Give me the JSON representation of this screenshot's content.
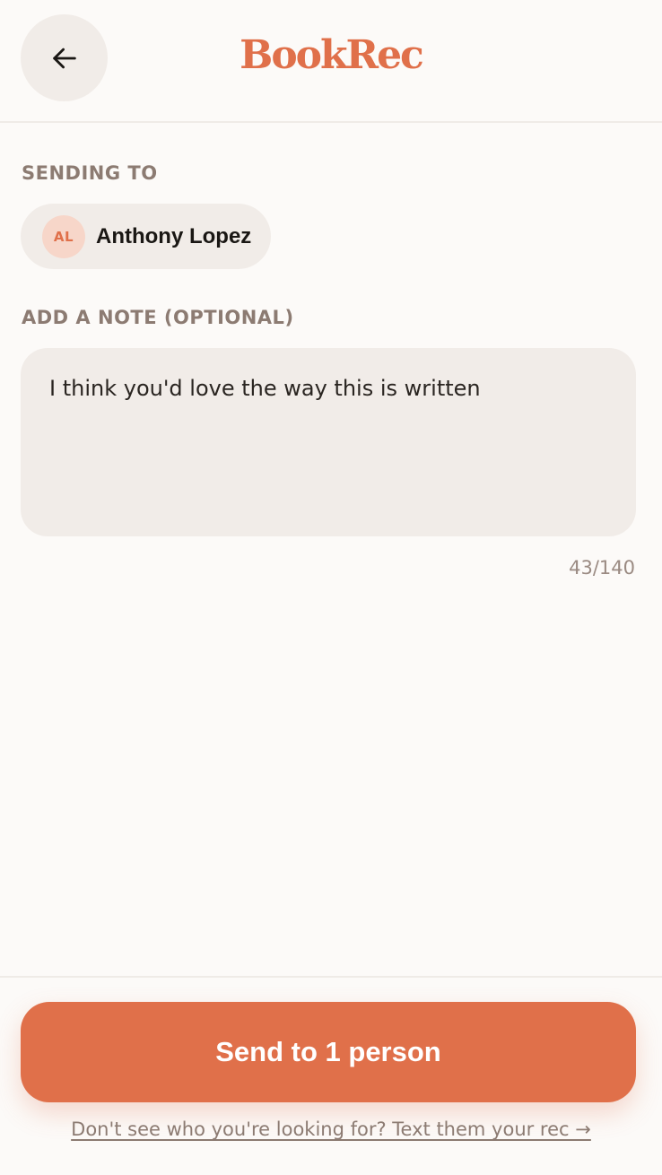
{
  "header": {
    "back_icon": "arrow-left-icon",
    "brand": "BookRec"
  },
  "sending_to": {
    "label": "SENDING TO",
    "recipient": {
      "initials": "AL",
      "name": "Anthony Lopez"
    }
  },
  "note": {
    "label": "ADD A NOTE (OPTIONAL)",
    "value": "I think you'd love the way this is written",
    "count": "43/140"
  },
  "footer": {
    "send_label": "Send to 1 person",
    "link_text": "Don't see who you're looking for? Text them your rec →"
  },
  "colors": {
    "accent": "#e0704a",
    "surface": "#f1ece8",
    "background": "#fcfaf8",
    "muted": "#8c7b72"
  }
}
